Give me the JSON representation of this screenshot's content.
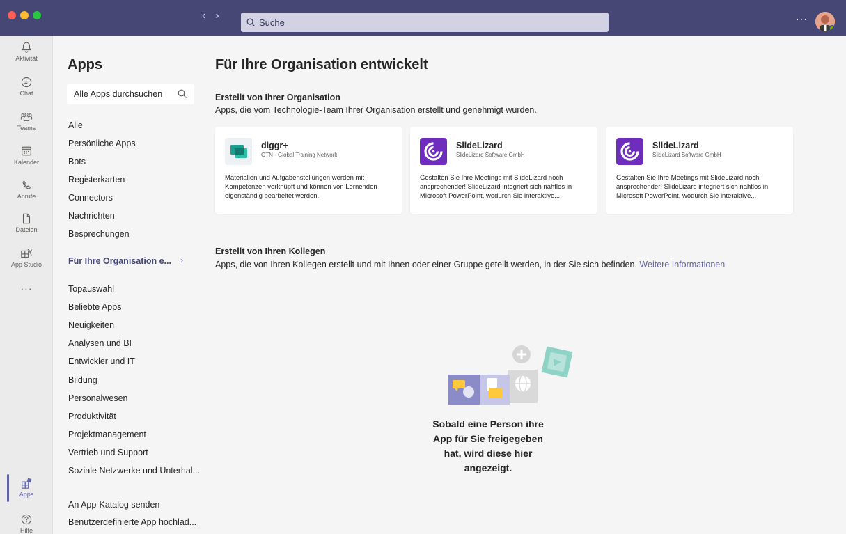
{
  "titlebar": {
    "search_placeholder": "Suche",
    "more": "···",
    "colors": {
      "bar": "#464775",
      "close": "#ff5f57",
      "minimize": "#febc2e",
      "maximize": "#28c840"
    }
  },
  "rail": {
    "items": [
      {
        "label": "Aktivität",
        "icon": "bell-icon"
      },
      {
        "label": "Chat",
        "icon": "chat-icon"
      },
      {
        "label": "Teams",
        "icon": "teams-icon"
      },
      {
        "label": "Kalender",
        "icon": "calendar-icon"
      },
      {
        "label": "Anrufe",
        "icon": "phone-icon"
      },
      {
        "label": "Dateien",
        "icon": "file-icon"
      },
      {
        "label": "App Studio",
        "icon": "app-studio-icon"
      },
      {
        "label": "···",
        "icon": "more-icon"
      }
    ],
    "bottom": [
      {
        "label": "Apps",
        "icon": "apps-icon",
        "active": true
      },
      {
        "label": "Hilfe",
        "icon": "help-icon"
      }
    ]
  },
  "apps": {
    "title": "Apps",
    "search_placeholder": "Alle Apps durchsuchen",
    "categories_top": [
      "Alle",
      "Persönliche Apps",
      "Bots",
      "Registerkarten",
      "Connectors",
      "Nachrichten",
      "Besprechungen"
    ],
    "selected": "Für Ihre Organisation e...",
    "categories": [
      "Topauswahl",
      "Beliebte Apps",
      "Neuigkeiten",
      "Analysen und BI",
      "Entwickler und IT",
      "Bildung",
      "Personalwesen",
      "Produktivität",
      "Projektmanagement",
      "Vertrieb und Support",
      "Soziale Netzwerke und Unterhal..."
    ],
    "bottom_links": [
      "An App-Katalog senden",
      "Benutzerdefinierte App hochlad..."
    ]
  },
  "main": {
    "title": "Für Ihre Organisation entwickelt",
    "org_section": {
      "title": "Erstellt von Ihrer Organisation",
      "desc": "Apps, die vom Technologie-Team Ihrer Organisation erstellt und genehmigt wurden."
    },
    "cards": [
      {
        "name": "diggr+",
        "publisher": "GTN - Global Training Network",
        "desc": "Materialien und Aufgabenstellungen werden mit Kompetenzen verknüpft und können von Lernenden eigenständig bearbeitet werden.",
        "icon": "diggr-logo-icon"
      },
      {
        "name": "SlideLizard",
        "publisher": "SlideLizard Software GmbH",
        "desc": "Gestalten Sie Ihre Meetings mit SlideLizard noch ansprechender! SlideLizard integriert sich nahtlos in Microsoft PowerPoint, wodurch Sie interaktive...",
        "icon": "slidelizard-logo-icon"
      },
      {
        "name": "SlideLizard",
        "publisher": "SlideLizard Software GmbH",
        "desc": "Gestalten Sie Ihre Meetings mit SlideLizard noch ansprechender! SlideLizard integriert sich nahtlos in Microsoft PowerPoint, wodurch Sie interaktive...",
        "icon": "slidelizard-logo-icon"
      }
    ],
    "colleagues_section": {
      "title": "Erstellt von Ihren Kollegen",
      "desc": "Apps, die von Ihren Kollegen erstellt und mit Ihnen oder einer Gruppe geteilt werden, in der Sie sich befinden.",
      "link": "Weitere Informationen"
    },
    "empty_message": "Sobald eine Person ihre App für Sie freigegeben hat, wird diese hier angezeigt."
  }
}
